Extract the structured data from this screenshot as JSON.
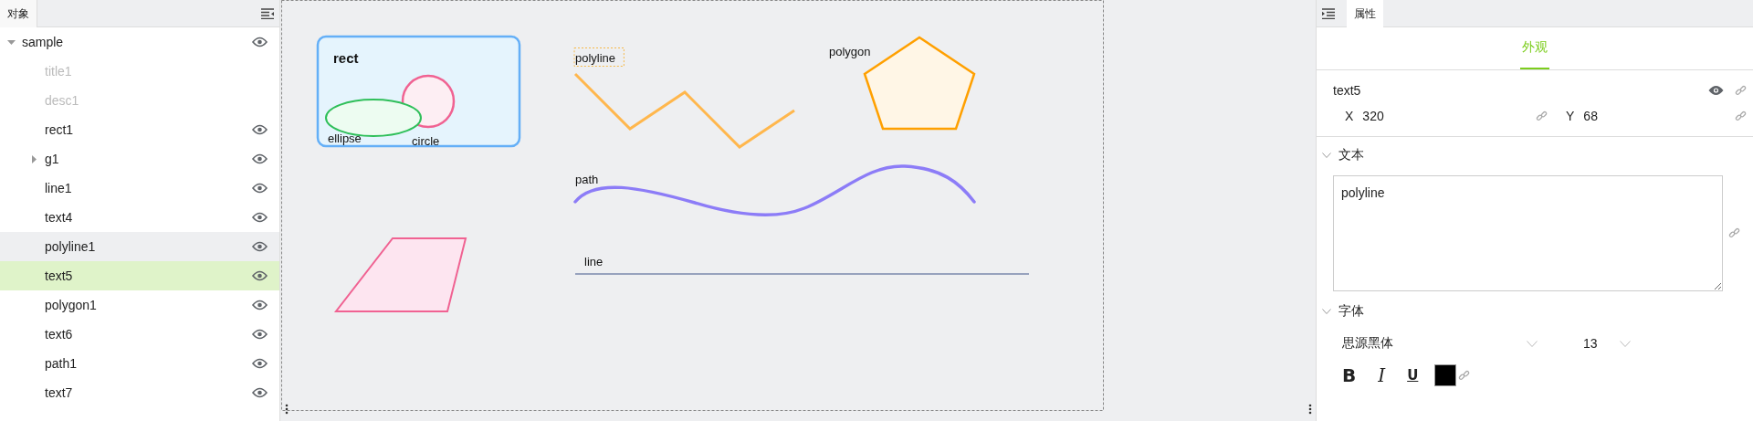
{
  "objects_panel": {
    "tab": {
      "label": "对象",
      "selected": true
    },
    "tree": [
      {
        "label": "sample",
        "expanded": true,
        "disabled": false,
        "selected": false,
        "highlighted": false,
        "children": [
          {
            "label": "title1",
            "disabled": true,
            "selected": false,
            "highlighted": false
          },
          {
            "label": "desc1",
            "disabled": true,
            "selected": false,
            "highlighted": false
          },
          {
            "label": "rect1",
            "disabled": false,
            "selected": false,
            "highlighted": false
          },
          {
            "label": "g1",
            "expanded": false,
            "disabled": false,
            "selected": false,
            "highlighted": false
          },
          {
            "label": "line1",
            "disabled": false,
            "selected": false,
            "highlighted": false
          },
          {
            "label": "text4",
            "disabled": false,
            "selected": false,
            "highlighted": false
          },
          {
            "label": "polyline1",
            "disabled": false,
            "selected": false,
            "highlighted": true
          },
          {
            "label": "text5",
            "disabled": false,
            "selected": true,
            "highlighted": false
          },
          {
            "label": "polygon1",
            "disabled": false,
            "selected": false,
            "highlighted": false
          },
          {
            "label": "text6",
            "disabled": false,
            "selected": false,
            "highlighted": false
          },
          {
            "label": "path1",
            "disabled": false,
            "selected": false,
            "highlighted": false
          },
          {
            "label": "text7",
            "disabled": false,
            "selected": false,
            "highlighted": false
          }
        ]
      }
    ]
  },
  "canvas": {
    "items": [
      {
        "kind": "rect",
        "text": "rect",
        "selected": false
      },
      {
        "kind": "circle",
        "text": "circle",
        "selected": false
      },
      {
        "kind": "ellipse",
        "text": "ellipse",
        "selected": false
      },
      {
        "kind": "polyline",
        "text": "polyline",
        "selected": true
      },
      {
        "kind": "polygon",
        "text": "polygon",
        "selected": false
      },
      {
        "kind": "path",
        "text": "path",
        "selected": false
      },
      {
        "kind": "line",
        "text": "line",
        "selected": false
      },
      {
        "kind": "parallelogram",
        "selected": false
      }
    ]
  },
  "properties_panel": {
    "tabs": [
      {
        "label": "属性",
        "selected": true
      }
    ],
    "subtabs": [
      {
        "label": "外观",
        "selected": true
      }
    ],
    "object_name": "text5",
    "visible": true,
    "x": {
      "label": "X",
      "value": "320"
    },
    "y": {
      "label": "Y",
      "value": "68"
    },
    "text_section": {
      "title": "文本",
      "expanded": true,
      "value": "polyline"
    },
    "font_section": {
      "title": "字体",
      "expanded": true,
      "family": "思源黑体",
      "size": "13",
      "styles": [
        {
          "label": "B",
          "kind": "bold"
        },
        {
          "label": "I",
          "kind": "italic"
        },
        {
          "label": "U",
          "kind": "underline"
        }
      ],
      "color": "#000000"
    }
  }
}
